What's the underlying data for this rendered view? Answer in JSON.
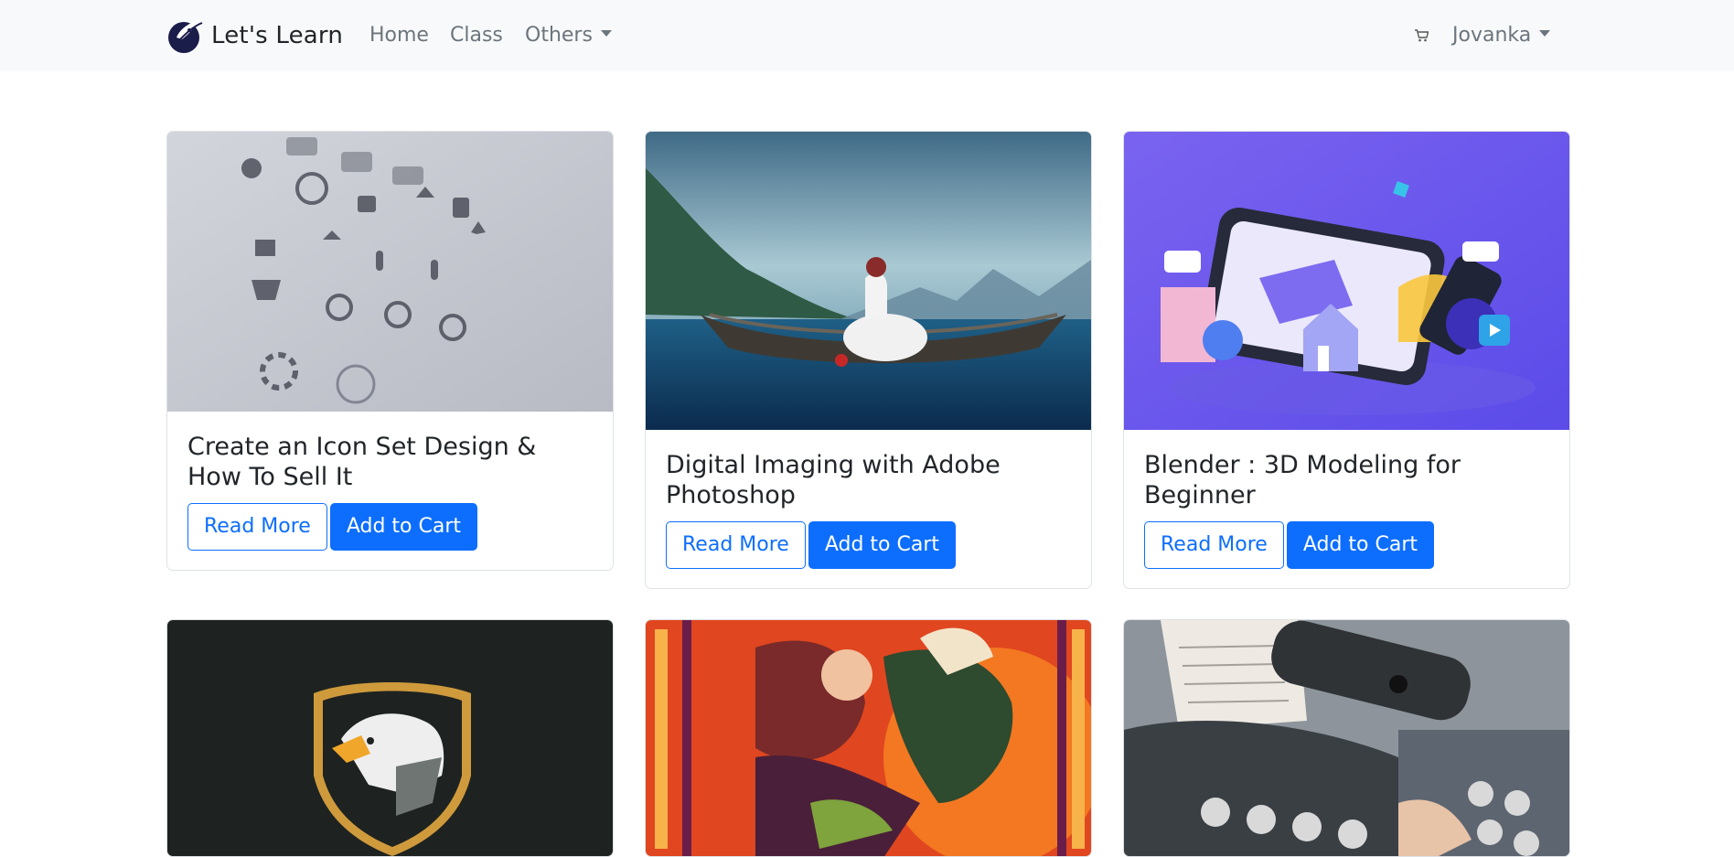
{
  "navbar": {
    "brand": "Let's Learn",
    "links": [
      "Home",
      "Class"
    ],
    "dropdown": "Others",
    "cart_icon": "cart-icon",
    "user": "Jovanka"
  },
  "courses": [
    {
      "title": "Create an Icon Set Design & How To Sell It",
      "read_more": "Read More",
      "add_to_cart": "Add to Cart"
    },
    {
      "title": "Digital Imaging with Adobe Photoshop",
      "read_more": "Read More",
      "add_to_cart": "Add to Cart"
    },
    {
      "title": "Blender : 3D Modeling for Beginner",
      "read_more": "Read More",
      "add_to_cart": "Add to Cart"
    }
  ],
  "colors": {
    "primary": "#0d6efd",
    "navbar_bg": "#f8f9fa",
    "text": "#212529",
    "nav_link": "#6c757d"
  }
}
